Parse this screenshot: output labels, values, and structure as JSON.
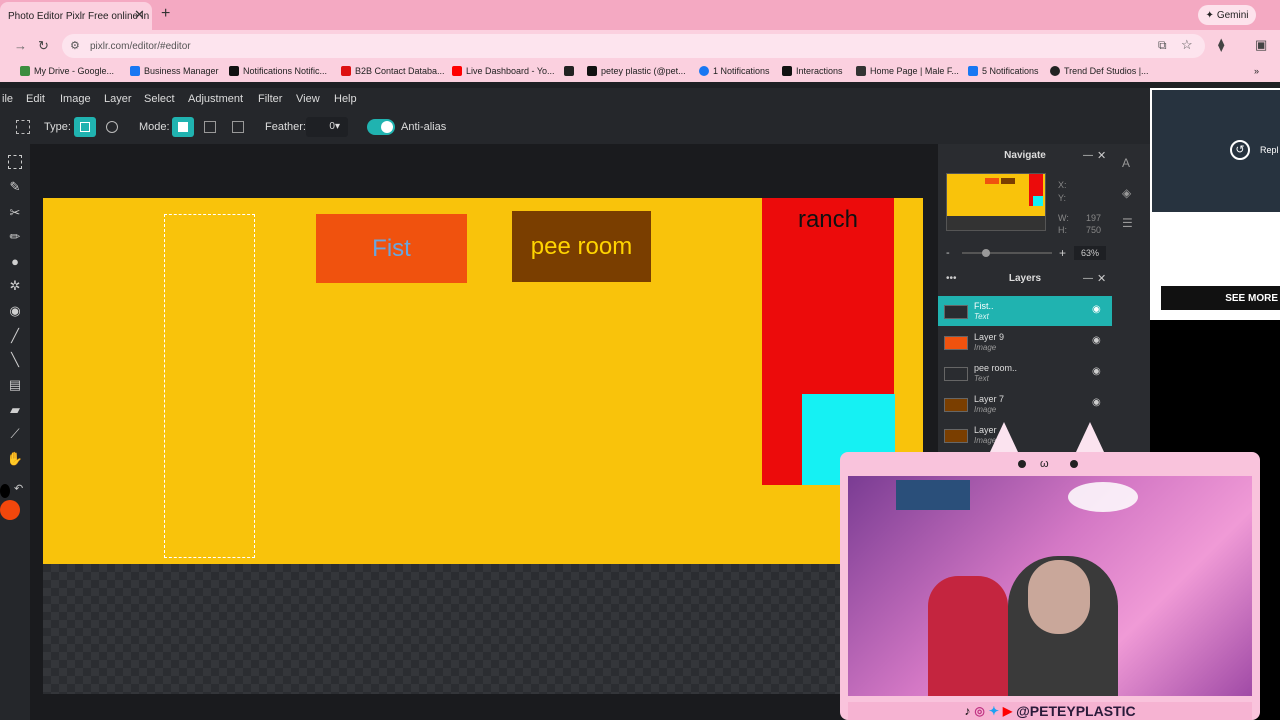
{
  "browser": {
    "tab_title": "Photo Editor Pixlr Free online In",
    "url": "pixlr.com/editor/#editor",
    "gemini_label": "Gemini",
    "bookmarks": [
      "My Drive - Google...",
      "Business Manager",
      "Notifications Notific...",
      "B2B Contact Databa...",
      "Live Dashboard - Yo...",
      "petey plastic (@pet...",
      "1 Notifications",
      "Interactions",
      "Home Page | Male F...",
      "5 Notifications",
      "Trend Def Studios |..."
    ]
  },
  "menu": [
    "ile",
    "Edit",
    "Image",
    "Layer",
    "Select",
    "Adjustment",
    "Filter",
    "View",
    "Help"
  ],
  "options": {
    "type_label": "Type:",
    "mode_label": "Mode:",
    "feather_label": "Feather:",
    "feather_value": "0",
    "antialias_label": "Anti-alias"
  },
  "canvas": {
    "fist_text": "Fist",
    "pee_text": "pee room",
    "ranch_text": "ranch"
  },
  "navigate": {
    "title": "Navigate",
    "x_label": "X:",
    "y_label": "Y:",
    "w_label": "W:",
    "w_value": "197",
    "h_label": "H:",
    "h_value": "750",
    "zoom": "63%"
  },
  "layers": {
    "title": "Layers",
    "items": [
      {
        "name": "Fist..",
        "type": "Text",
        "color": "#2a2c30"
      },
      {
        "name": "Layer 9",
        "type": "Image",
        "color": "#f0520e"
      },
      {
        "name": "pee room..",
        "type": "Text",
        "color": "#2a2c30"
      },
      {
        "name": "Layer 7",
        "type": "Image",
        "color": "#7a3e00"
      },
      {
        "name": "Layer",
        "type": "Image",
        "color": "#7a3e00"
      }
    ]
  },
  "ad": {
    "see_more": "SEE MORE",
    "replay": "Repl"
  },
  "webcam": {
    "handle": "@PETEYPLASTIC"
  }
}
